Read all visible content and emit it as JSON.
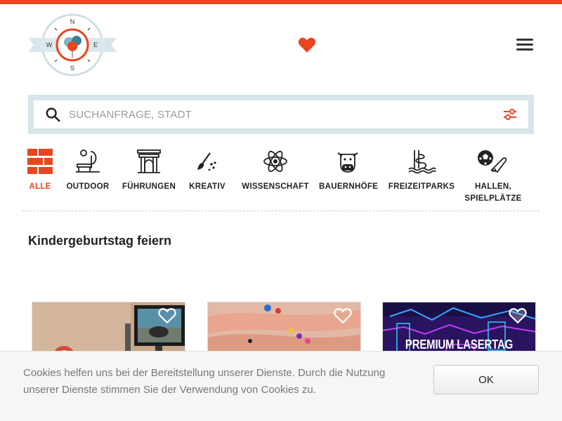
{
  "header": {
    "logo_letters": [
      "N",
      "E",
      "S",
      "W"
    ],
    "brand_color": "#e8461f"
  },
  "search": {
    "placeholder": "SUCHANFRAGE, STADT",
    "value": ""
  },
  "categories": [
    {
      "label": "ALLE",
      "icon": "grid-icon",
      "active": true
    },
    {
      "label": "OUTDOOR",
      "icon": "outdoor-bench-icon",
      "active": false
    },
    {
      "label": "FÜHRUNGEN",
      "icon": "building-icon",
      "active": false
    },
    {
      "label": "KREATIV",
      "icon": "paintbrush-icon",
      "active": false
    },
    {
      "label": "WISSENSCHAFT",
      "icon": "atom-icon",
      "active": false
    },
    {
      "label": "BAUERNHÖFE",
      "icon": "cow-icon",
      "active": false
    },
    {
      "label": "FREIZEITPARKS",
      "icon": "waterslide-icon",
      "active": false
    },
    {
      "label": "HALLEN, SPIELPLÄTZE",
      "label_line1": "HALLEN,",
      "label_line2": "SPIELPLÄTZE",
      "icon": "soccer-shoe-icon",
      "active": false
    }
  ],
  "main": {
    "heading": "Kindergeburtstag feiern"
  },
  "cards": [
    {
      "image": "racing-simulator-photo"
    },
    {
      "image": "bracelets-hands-photo"
    },
    {
      "image": "lasertag-arena-photo",
      "overlay_text": "PREMIUM LASERTAG"
    }
  ],
  "cookie": {
    "text": "Cookies helfen uns bei der Bereitstellung unserer Dienste. Durch die Nutzung unserer Dienste stimmen Sie der Verwendung von Cookies zu.",
    "ok_label": "OK"
  }
}
